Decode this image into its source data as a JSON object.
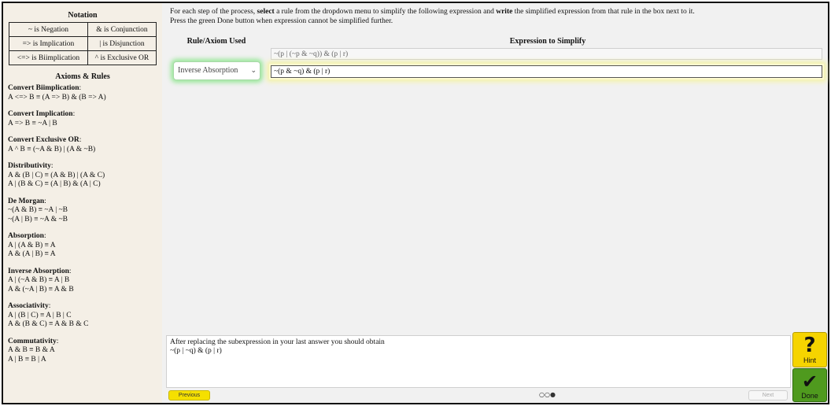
{
  "sidebar": {
    "notation_title": "Notation",
    "notation": [
      [
        "~ is Negation",
        "& is Conjunction"
      ],
      [
        "=> is Implication",
        "| is Disjunction"
      ],
      [
        "<=> is Biimplication",
        "^ is Exclusive OR"
      ]
    ],
    "axioms_title": "Axioms & Rules",
    "rules": [
      {
        "name": "Convert Biimplication",
        "lines": [
          "A <=> B ≡ (A => B) & (B => A)"
        ]
      },
      {
        "name": "Convert Implication",
        "lines": [
          "A => B ≡ ~A | B"
        ]
      },
      {
        "name": "Convert Exclusive OR",
        "lines": [
          "A ^ B ≡ (~A & B) | (A & ~B)"
        ]
      },
      {
        "name": "Distributivity",
        "lines": [
          "A & (B | C) ≡ (A & B) | (A & C)",
          "A | (B & C) ≡ (A | B) & (A | C)"
        ]
      },
      {
        "name": "De Morgan",
        "lines": [
          "~(A & B) ≡ ~A | ~B",
          "~(A | B) ≡ ~A & ~B"
        ]
      },
      {
        "name": "Absorption",
        "lines": [
          "A | (A & B) ≡ A",
          "A & (A | B) ≡ A"
        ]
      },
      {
        "name": "Inverse Absorption",
        "lines": [
          "A | (~A & B) ≡ A | B",
          "A & (~A | B) ≡ A & B"
        ]
      },
      {
        "name": "Associativity",
        "lines": [
          "A | (B | C) ≡ A | B | C",
          "A & (B & C) ≡ A & B & C"
        ]
      },
      {
        "name": "Commutativity",
        "lines": [
          "A & B ≡ B & A",
          "A | B ≡ B | A"
        ]
      }
    ]
  },
  "main": {
    "instructions": {
      "p1": "For each step of the process, ",
      "b1": "select",
      "p2": " a rule from the dropdown menu to simplify the following expression and ",
      "b2": "write",
      "p3": " the simplified expression from that rule in the box next to it.",
      "line2": "Press the green Done button when expression cannot be simplified further."
    },
    "col_rule": "Rule/Axiom Used",
    "col_expr": "Expression to Simplify",
    "previous_expression": "~(p | (~p & ~q)) & (p | r)",
    "selected_rule": "Inverse Absorption",
    "current_expression": "~(p & ~q) & (p | r)",
    "feedback_line1": "After replacing the subexpression in your last answer you should obtain",
    "feedback_line2": "~(p | ~q) & (p | r)",
    "previous_label": "Previous",
    "next_label": "Next",
    "page_dots": "○○●",
    "hint_symbol": "?",
    "hint_label": "Hint",
    "done_symbol": "✔",
    "done_label": "Done"
  },
  "colors": {
    "sidebar_bg": "#f4efe6",
    "main_bg": "#f1f1f1",
    "hint_yellow": "#f6d400",
    "done_green": "#4f9a1e",
    "select_glow": "#9be89b",
    "input_glow": "#f4f3a8"
  }
}
